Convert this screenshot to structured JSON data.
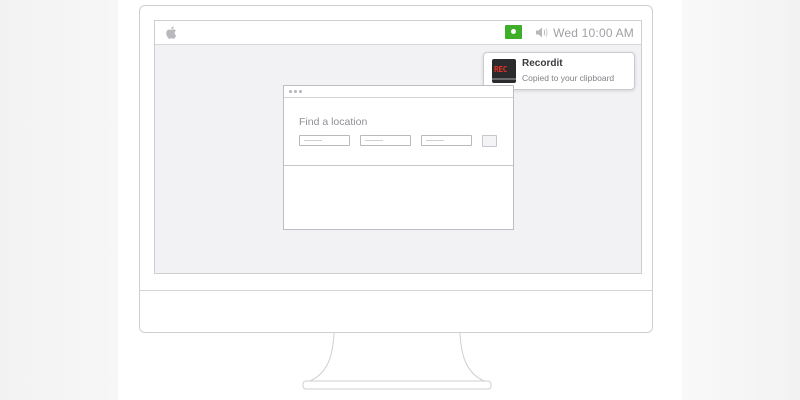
{
  "menubar": {
    "apple_icon": "apple-logo-icon",
    "recording_icon": "recording-indicator-icon",
    "volume_icon": "speaker-icon",
    "clock": "Wed 10:00 AM"
  },
  "notification": {
    "app_icon": "recordit-app-icon",
    "icon_text": "REC",
    "title": "Recordit",
    "message": "Copied to your clipboard"
  },
  "window": {
    "heading": "Find a location",
    "fields": [
      "",
      "",
      ""
    ],
    "colors": {
      "rec_green": "#3fae29",
      "rec_red": "#e03324"
    }
  }
}
